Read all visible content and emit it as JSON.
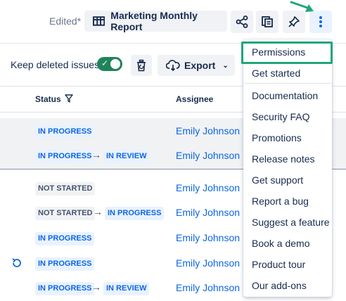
{
  "header": {
    "edited_label": "Edited*",
    "report_title": "Marketing Monthly Report",
    "icons": [
      "table-icon",
      "share-icon",
      "copy-icon",
      "pin-icon",
      "more-vertical-icon"
    ]
  },
  "toolbar": {
    "keep_deleted_label": "Keep deleted issues",
    "keep_deleted_enabled": true,
    "export_label": "Export"
  },
  "table": {
    "columns": [
      "Status",
      "Assignee"
    ],
    "rows": [
      {
        "status": [
          "IN PROGRESS"
        ],
        "assignee": "Emily Johnson"
      },
      {
        "status": [
          "IN PROGRESS",
          "IN REVIEW"
        ],
        "assignee": "Emily Johnson"
      },
      {
        "status": [
          "NOT STARTED"
        ],
        "assignee": "Emily Johnson"
      },
      {
        "status": [
          "NOT STARTED",
          "IN PROGRESS"
        ],
        "assignee": "Emily Johnson"
      },
      {
        "status": [
          "IN PROGRESS"
        ],
        "assignee": "Emily Johnson"
      },
      {
        "status": [
          "IN PROGRESS"
        ],
        "assignee": "Emily Johnson"
      },
      {
        "status": [
          "IN PROGRESS",
          "IN REVIEW"
        ],
        "assignee": "Emily Johnson"
      }
    ]
  },
  "menu": {
    "items": [
      "Permissions",
      "Get started",
      "Documentation",
      "Security FAQ",
      "Promotions",
      "Release notes",
      "Get support",
      "Report a bug",
      "Suggest a feature",
      "Book a demo",
      "Product tour",
      "Our add-ons"
    ],
    "highlighted": "Permissions"
  },
  "colors": {
    "accent": "#0c66e4",
    "toggle_on": "#1f845a",
    "annotation": "#1fa67a"
  }
}
